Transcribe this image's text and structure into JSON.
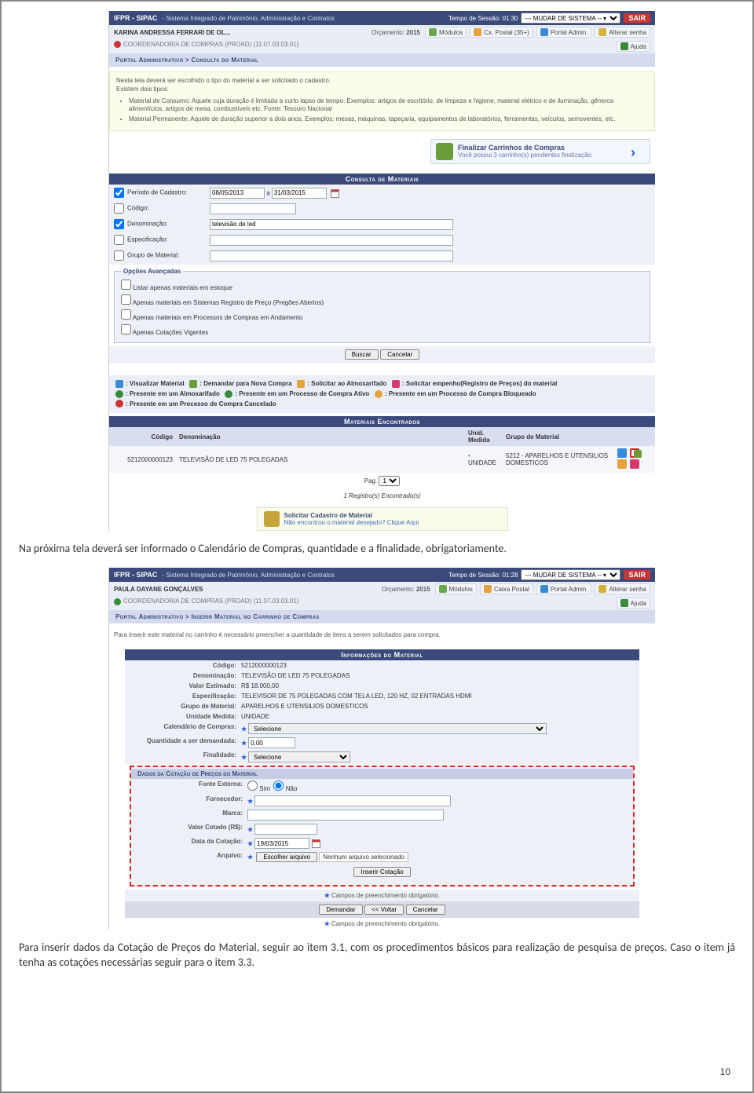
{
  "page_number": "10",
  "doc": {
    "para1": "Na próxima tela deverá  ser informado o Calendário de Compras,  quantidade e a finalidade, obrigatoriamente.",
    "para2": "Para inserir dados da Cotação de Preços do Material, seguir ao item 3.1, com os procedimentos básicos para realização de pesquisa de preços.  Caso o item já tenha as cotações necessárias seguir para o item 3.3."
  },
  "app1": {
    "brand": "IFPR - SIPAC",
    "subtitle": "- Sistema Integrado de Patrimônio, Administração e Contratos",
    "session": "Tempo de Sessão: 01:30",
    "system_switch": "--- MUDAR DE SISTEMA -- ▾",
    "sair": "SAIR",
    "user": "KARINA ANDRESSA FERRARI DE OL...",
    "budget_label": "Orçamento:",
    "budget_year": "2015",
    "tools": {
      "modulos": "Módulos",
      "caixa": "Cx. Postal (35+)",
      "portal": "Portal Admin.",
      "senha": "Alterar senha",
      "ajuda": "Ajuda"
    },
    "dept": "COORDENADORIA DE COMPRAS (PROAD) (11.07.03.03.01)",
    "breadcrumb": "Portal Administrativo > Consulta do Material",
    "info_intro": "Nesta tela deverá ser escolhido o tipo do material a ser solicitado o cadastro.",
    "info_sub": "Existem dois tipos:",
    "info_li1": "Material de Consumo: Aquele cuja duração é limitada a curto lapso de tempo. Exemplos: artigos de escritório, de limpeza e higiene, material elétrico e de iluminação, gêneros alimentícios, artigos de mesa, combustíveis etc. Fonte: Tesouro Nacional",
    "info_li2": "Material Permanente: Aquele de duração superior a dois anos. Exemplos: mesas, máquinas, tapeçaria, equipamentos de laboratórios, ferramentas, veículos, semoventes, etc.",
    "cart_title": "Finalizar Carrinhos de Compras",
    "cart_sub": "Você possui 3 carrinho(s) pendentes finalização",
    "section_consulta": "Consulta de Materiais",
    "fields": {
      "periodo": "Período de Cadastro:",
      "periodo_de": "08/05/2013",
      "periodo_a_label": "a",
      "periodo_ate": "31/03/2015",
      "codigo": "Código:",
      "denominacao": "Denominação:",
      "denominacao_val": "televisão de led",
      "especificacao": "Especificação:",
      "grupo": "Grupo de Material:"
    },
    "adv_legend": "Opções Avançadas",
    "adv_opts": [
      "Listar apenas materiais em estoque",
      "Apenas materiais em Sistemas Registro de Preço (Pregões Abertos)",
      "Apenas materiais em Processos de Compras em Andamento",
      "Apenas Cotações Vigentes"
    ],
    "btn_buscar": "Buscar",
    "btn_cancelar": "Cancelar",
    "legend": {
      "l1a": ": Visualizar Material",
      "l1b": ": Demandar para Nova Compra",
      "l1c": ": Solicitar ao Almoxarifado",
      "l1d": ": Solicitar empenho(Registro de Preços) do material",
      "l2a": ": Presente em um Almoxarifado",
      "l2b": ": Presente em um Processo de Compra Ativo",
      "l2c": ": Presente em um Processo de Compra Bloqueado",
      "l3": ": Presente em um Processo de Compra Cancelado"
    },
    "section_materiais": "Materiais Encontrados",
    "tbl": {
      "h1": "Código",
      "h2": "Denominação",
      "h3": "Unid. Medida",
      "h4": "Grupo de Material",
      "r_codigo": "5212000000123",
      "r_denom": "TELEVISÃO DE LED 75 POLEGADAS",
      "r_unid": "UNIDADE",
      "r_grupo": "5212 - APARELHOS E UTENSILIOS DOMESTICOS"
    },
    "pager_label": "Pag.",
    "pager_val": "1",
    "found": "1 Registro(s) Encontrado(s)",
    "cad_t1": "Solicitar Cadastro de Material",
    "cad_t2": "Não encontrou o material desejado? Clique Aqui"
  },
  "app2": {
    "brand": "IFPR - SIPAC",
    "subtitle": "- Sistema Integrado de Patrimônio, Administração e Contratos",
    "session": "Tempo de Sessão: 01:28",
    "system_switch": "--- MUDAR DE SISTEMA -- ▾",
    "sair": "SAIR",
    "user": "PAULA DAYANE GONÇALVES",
    "budget_label": "Orçamento:",
    "budget_year": "2015",
    "tools": {
      "modulos": "Módulos",
      "caixa": "Caixa Postal",
      "portal": "Portal Admin.",
      "senha": "Alterar senha",
      "ajuda": "Ajuda"
    },
    "dept": "COORDENADORIA DE COMPRAS (PROAD) (11.07.03.03.01)",
    "breadcrumb": "Portal Administrativo > Inserir Material no Carrinho de Compras",
    "info": "Para inserir este material no carrinho é necessário preencher a quantidade de itens a serem solicitados para compra.",
    "section_info": "Informações do Material",
    "rows": {
      "codigo_k": "Código:",
      "codigo_v": "5212000000123",
      "denom_k": "Denominação:",
      "denom_v": "TELEVISÃO DE LED 75 POLEGADAS",
      "valor_k": "Valor Estimado:",
      "valor_v": "R$ 18.000,00",
      "espec_k": "Especificação:",
      "espec_v": "TELEVISOR DE 75 POLEGADAS COM TELA LED, 120 HZ, 02 ENTRADAS HDMI",
      "grupo_k": "Grupo de Material:",
      "grupo_v": "APARELHOS E UTENSILIOS DOMESTICOS",
      "unid_k": "Unidade Medida:",
      "unid_v": "UNIDADE",
      "cal_k": "Calendário de Compras:",
      "cal_v": "Selecione",
      "qtd_k": "Quantidade a ser demandada:",
      "qtd_v": "0,00",
      "fin_k": "Finalidade:",
      "fin_v": "Selecione"
    },
    "section_cot": "Dados da Cotação de Preços do Material",
    "cot": {
      "fonte_k": "Fonte Externa:",
      "fonte_sim": "Sim",
      "fonte_nao": "Não",
      "forn_k": "Fornecedor:",
      "marca_k": "Marca:",
      "valor_k": "Valor Cotado (R$):",
      "data_k": "Data da Cotação:",
      "data_v": "19/03/2015",
      "arq_k": "Arquivo:",
      "arq_btn": "Escolher arquivo",
      "arq_none": "Nenhum arquivo selecionado",
      "btn_inserir": "Inserir Cotação"
    },
    "note_req": "Campos de preenchimento obrigatório.",
    "btn_demandar": "Demandar",
    "btn_voltar": "<< Voltar",
    "btn_cancelar": "Cancelar"
  }
}
